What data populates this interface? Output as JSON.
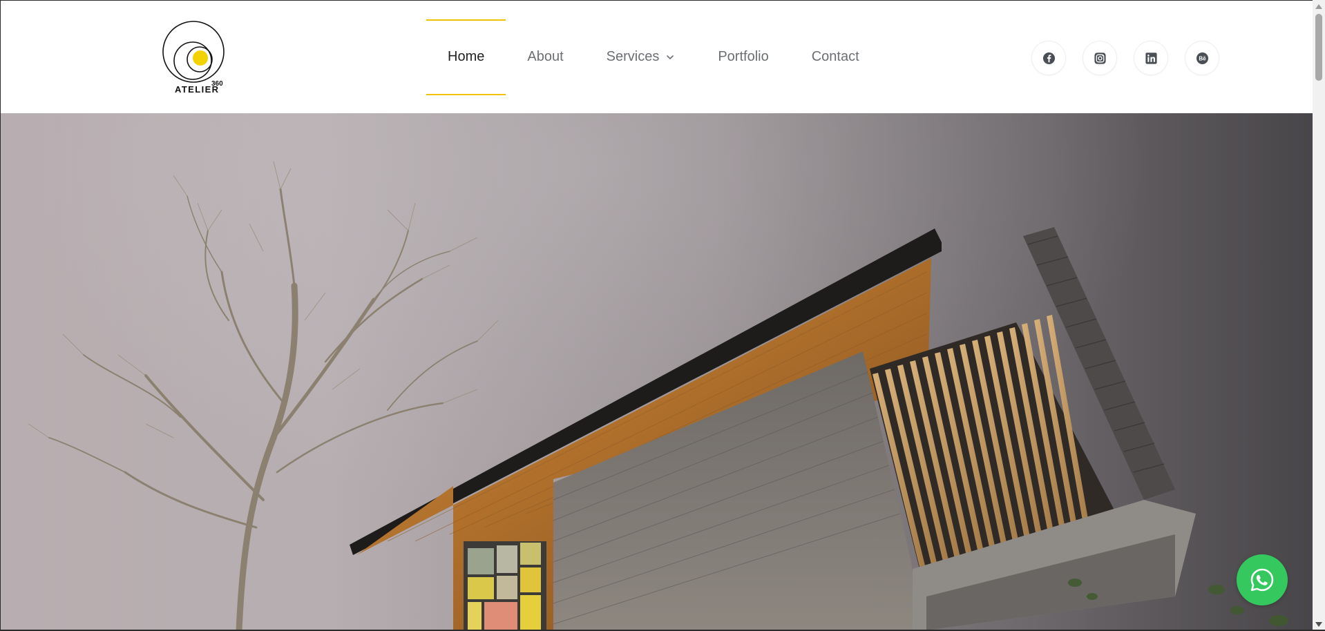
{
  "logo": {
    "text": "ATELIER",
    "superscript": "360",
    "accent_color": "#f2d300"
  },
  "nav": {
    "items": [
      {
        "label": "Home",
        "active": true
      },
      {
        "label": "About",
        "active": false
      },
      {
        "label": "Services",
        "active": false,
        "has_dropdown": true
      },
      {
        "label": "Portfolio",
        "active": false
      },
      {
        "label": "Contact",
        "active": false
      }
    ],
    "active_underline_color": "#f2c200"
  },
  "socials": [
    {
      "icon": "facebook-icon"
    },
    {
      "icon": "instagram-icon"
    },
    {
      "icon": "linkedin-icon"
    },
    {
      "icon": "behance-icon"
    }
  ],
  "hero": {
    "image": "modern-house-with-cantilevered-wood-roof-and-bare-tree-at-dusk"
  },
  "floating_button": {
    "icon": "whatsapp-icon",
    "color": "#35c85f"
  },
  "colors": {
    "nav_text": "#6b6f73",
    "nav_active_text": "#222222",
    "header_bg": "#ffffff"
  }
}
